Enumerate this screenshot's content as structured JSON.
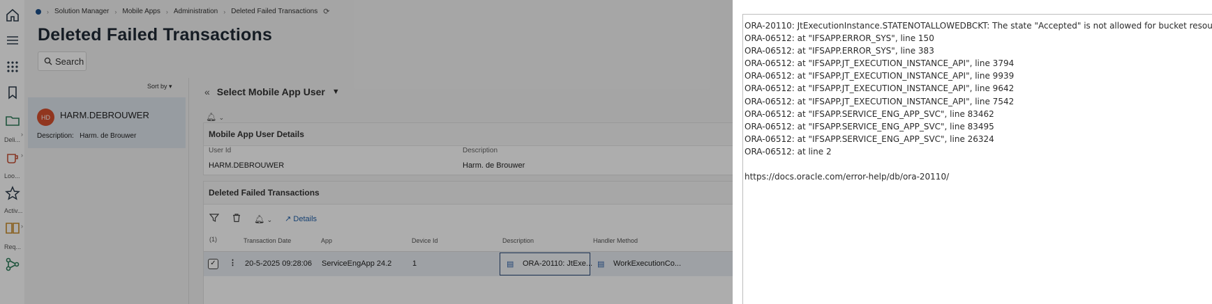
{
  "rail": {
    "labels": [
      "Deli...",
      "Loo...",
      "Activ...",
      "Req..."
    ]
  },
  "breadcrumb": [
    "Solution Manager",
    "Mobile Apps",
    "Administration",
    "Deleted Failed Transactions"
  ],
  "page": {
    "title": "Deleted Failed Transactions",
    "search_label": "Search",
    "sort_label": "Sort by"
  },
  "user_card": {
    "initials": "HD",
    "name": "HARM.DEBROUWER",
    "description_label": "Description:",
    "description": "Harm. de Brouwer"
  },
  "detail": {
    "select_label": "Select Mobile App User",
    "user_details_title": "Mobile App User Details",
    "user_id_label": "User Id",
    "user_id": "HARM.DEBROUWER",
    "description_label": "Description",
    "description": "Harm. de Brouwer",
    "transactions_title": "Deleted Failed Transactions",
    "details_label": "Details",
    "selected_count": "(1)",
    "columns": [
      "Transaction Date",
      "App",
      "Device Id",
      "Description",
      "Handler Method"
    ],
    "row": {
      "date": "20-5-2025 09:28:06",
      "app": "ServiceEngApp 24.2",
      "device_id": "1",
      "description": "ORA-20110: JtExe...",
      "handler": "WorkExecutionCo..."
    }
  },
  "error": {
    "lines": [
      "ORA-20110: JtExecutionInstance.STATENOTALLOWEDBCKT: The state \"Accepted\" is not allowed for bucket resou",
      "ORA-06512: at \"IFSAPP.ERROR_SYS\", line 150",
      "ORA-06512: at \"IFSAPP.ERROR_SYS\", line 383",
      "ORA-06512: at \"IFSAPP.JT_EXECUTION_INSTANCE_API\", line 3794",
      "ORA-06512: at \"IFSAPP.JT_EXECUTION_INSTANCE_API\", line 9939",
      "ORA-06512: at \"IFSAPP.JT_EXECUTION_INSTANCE_API\", line 9642",
      "ORA-06512: at \"IFSAPP.JT_EXECUTION_INSTANCE_API\", line 7542",
      "ORA-06512: at \"IFSAPP.SERVICE_ENG_APP_SVC\", line 83462",
      "ORA-06512: at \"IFSAPP.SERVICE_ENG_APP_SVC\", line 83495",
      "ORA-06512: at \"IFSAPP.SERVICE_ENG_APP_SVC\", line 26324",
      "ORA-06512: at line 2"
    ],
    "link": "https://docs.oracle.com/error-help/db/ora-20110/"
  },
  "colors": {
    "avatar": "#d6502f",
    "brand_dot": "#1b4f8a",
    "link": "#1f5fa8"
  }
}
